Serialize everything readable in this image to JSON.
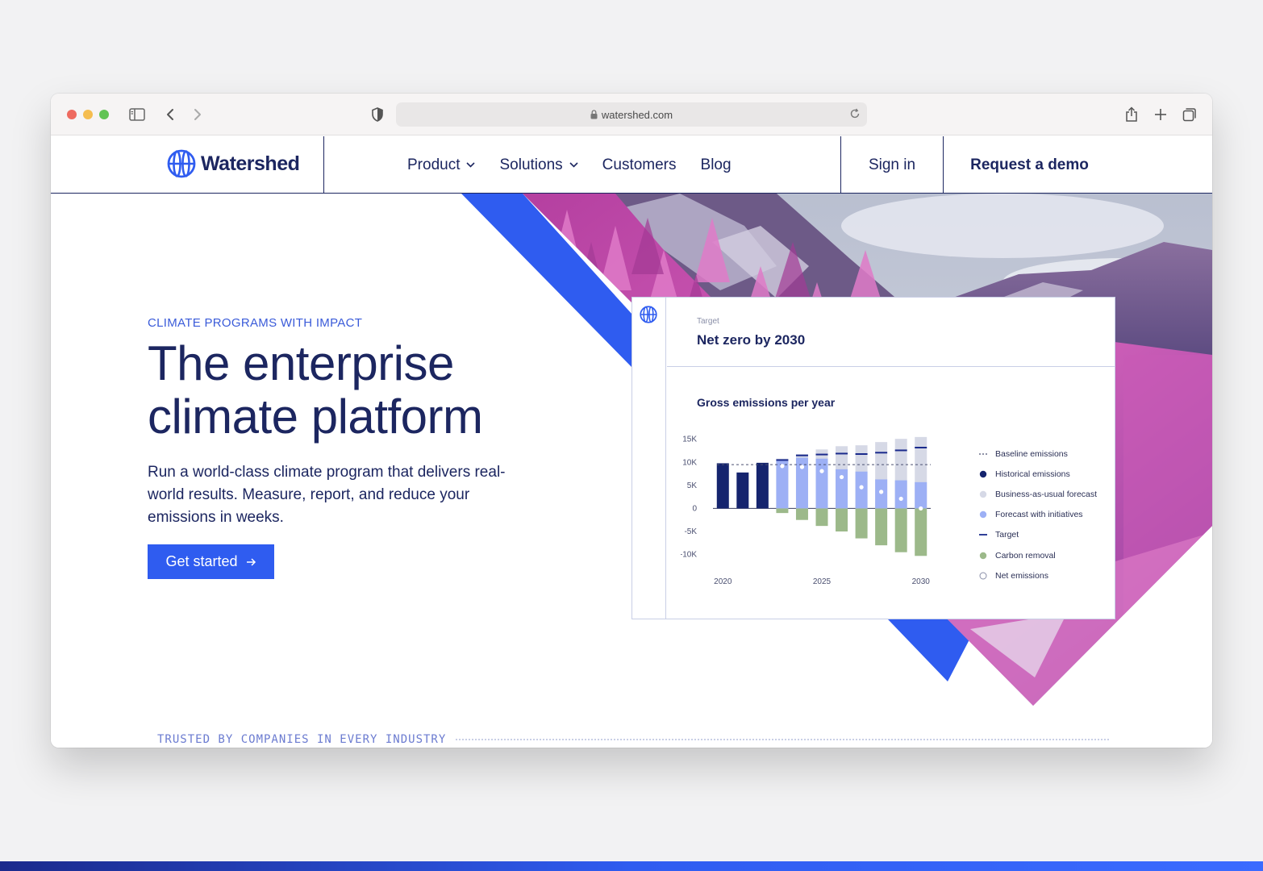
{
  "browser": {
    "url": "watershed.com"
  },
  "nav": {
    "logo": "Watershed",
    "links": [
      {
        "label": "Product",
        "has_dropdown": true
      },
      {
        "label": "Solutions",
        "has_dropdown": true
      },
      {
        "label": "Customers",
        "has_dropdown": false
      },
      {
        "label": "Blog",
        "has_dropdown": false
      }
    ],
    "sign_in": "Sign in",
    "request_demo": "Request a demo"
  },
  "hero": {
    "eyebrow": "CLIMATE PROGRAMS WITH IMPACT",
    "headline_line1": "The enterprise",
    "headline_line2": "climate platform",
    "subtext": "Run a world-class climate program that delivers real-world results. Measure, report, and reduce your emissions in weeks.",
    "cta": "Get started",
    "trusted": "TRUSTED BY COMPANIES IN EVERY INDUSTRY"
  },
  "colors": {
    "brand_navy": "#1c2660",
    "brand_blue": "#2f5cf0",
    "eyebrow_blue": "#3a5bd9"
  },
  "card": {
    "label": "Target",
    "title": "Net zero by 2030",
    "chart_title": "Gross emissions per year"
  },
  "chart_data": {
    "type": "bar",
    "title": "Gross emissions per year",
    "ylim": [
      -12000,
      16000
    ],
    "yticks": [
      {
        "value": 15000,
        "label": "15K"
      },
      {
        "value": 10000,
        "label": "10K"
      },
      {
        "value": 5000,
        "label": "5K"
      },
      {
        "value": 0,
        "label": "0"
      },
      {
        "value": -5000,
        "label": "-5K"
      },
      {
        "value": -10000,
        "label": "-10K"
      }
    ],
    "xticks": [
      {
        "year": 2020,
        "label": "2020"
      },
      {
        "year": 2025,
        "label": "2025"
      },
      {
        "year": 2030,
        "label": "2030"
      }
    ],
    "baseline": 9500,
    "years": [
      2020,
      2021,
      2022,
      2023,
      2024,
      2025,
      2026,
      2027,
      2028,
      2029,
      2030
    ],
    "historical": [
      9800,
      7800,
      9900,
      null,
      null,
      null,
      null,
      null,
      null,
      null,
      null
    ],
    "bau_forecast": [
      null,
      null,
      null,
      10800,
      11800,
      12800,
      13500,
      13700,
      14400,
      15100,
      15500
    ],
    "forecast_with_initiatives": [
      null,
      null,
      null,
      10400,
      11000,
      10800,
      8500,
      8000,
      6300,
      6100,
      5700
    ],
    "target": [
      null,
      null,
      null,
      10500,
      11500,
      11700,
      11900,
      11800,
      12100,
      12600,
      13200
    ],
    "carbon_removal": [
      null,
      null,
      null,
      -1000,
      -2500,
      -3800,
      -5000,
      -6500,
      -8000,
      -9500,
      -10300
    ],
    "net_emissions": [
      null,
      null,
      null,
      9200,
      9000,
      8100,
      6800,
      4600,
      3600,
      2100,
      0
    ],
    "legend": [
      {
        "key": "baseline",
        "label": "Baseline emissions",
        "color": "#4a4f70"
      },
      {
        "key": "historical",
        "label": "Historical emissions",
        "color": "#15246e"
      },
      {
        "key": "bau_forecast",
        "label": "Business-as-usual forecast",
        "color": "#d6d9e6"
      },
      {
        "key": "forecast_with_initiatives",
        "label": "Forecast with initiatives",
        "color": "#9db0f5"
      },
      {
        "key": "target",
        "label": "Target",
        "color": "#1a2a8c"
      },
      {
        "key": "carbon_removal",
        "label": "Carbon removal",
        "color": "#9cb98a"
      },
      {
        "key": "net_emissions",
        "label": "Net emissions",
        "color": "#ffffff"
      }
    ]
  }
}
